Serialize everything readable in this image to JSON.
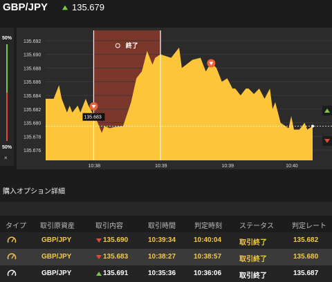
{
  "header": {
    "pair": "GBP/JPY",
    "price": "135.679"
  },
  "side_panel": {
    "pct_top": "50%",
    "pct_bottom": "50%",
    "close": "×"
  },
  "chart_overlay": {
    "expiry_label": "終了",
    "crosshair_price": "135.683"
  },
  "chart_data": {
    "type": "area",
    "yticks": [
      "135.692",
      "135.690",
      "135.688",
      "135.686",
      "135.684",
      "135.682",
      "135.680",
      "135.678",
      "135.676"
    ],
    "xticks": [
      "10:38",
      "10:39",
      "10:39",
      "10:40"
    ],
    "ylim": [
      135.6745,
      135.6935
    ],
    "x": [
      0,
      3,
      5,
      6,
      8,
      9,
      10,
      12,
      13,
      15,
      16,
      19,
      21,
      22,
      24,
      26,
      29,
      32,
      34,
      36,
      38,
      40,
      41,
      43,
      47,
      50,
      51,
      55,
      58,
      60,
      62,
      64,
      66,
      68,
      70,
      71,
      73,
      75,
      76,
      78,
      80,
      82,
      84,
      85,
      86,
      88,
      91,
      92,
      93,
      95,
      97,
      98,
      100
    ],
    "y": [
      135.6835,
      135.6835,
      135.6855,
      135.6835,
      135.6815,
      135.6825,
      135.6815,
      135.6825,
      135.6815,
      135.6835,
      135.6825,
      135.6805,
      135.6785,
      135.6795,
      135.6792,
      135.6794,
      135.6795,
      135.683,
      135.6865,
      135.6875,
      135.6905,
      135.6885,
      135.6895,
      135.69,
      135.6895,
      135.691,
      135.688,
      135.6892,
      135.6895,
      135.6875,
      135.6888,
      135.688,
      135.686,
      135.6865,
      135.685,
      135.685,
      135.684,
      135.685,
      135.685,
      135.6842,
      135.685,
      135.6835,
      135.685,
      135.682,
      135.683,
      135.68,
      135.6792,
      135.681,
      135.679,
      135.679,
      135.68,
      135.679,
      135.6795
    ],
    "series_color": "#fcc53a",
    "expiry_band_color": "#8b3a2c"
  },
  "panel": {
    "title": "購入オプション詳細"
  },
  "table": {
    "headers": [
      "タイプ",
      "取引原資産",
      "取引内容",
      "取引時間",
      "判定時刻",
      "ステータス",
      "判定レート"
    ],
    "rows": [
      [
        "GBP/JPY",
        "135.690",
        "10:39:34",
        "10:40:04",
        "取引終了",
        "135.682"
      ],
      [
        "GBP/JPY",
        "135.683",
        "10:38:27",
        "10:38:57",
        "取引終了",
        "135.680"
      ],
      [
        "GBP/JPY",
        "135.691",
        "10:35:36",
        "10:36:06",
        "取引終了",
        "135.687"
      ]
    ]
  },
  "colors": {
    "accent": "#fcc53a",
    "down": "#e04a3a",
    "up": "#7ac943"
  }
}
